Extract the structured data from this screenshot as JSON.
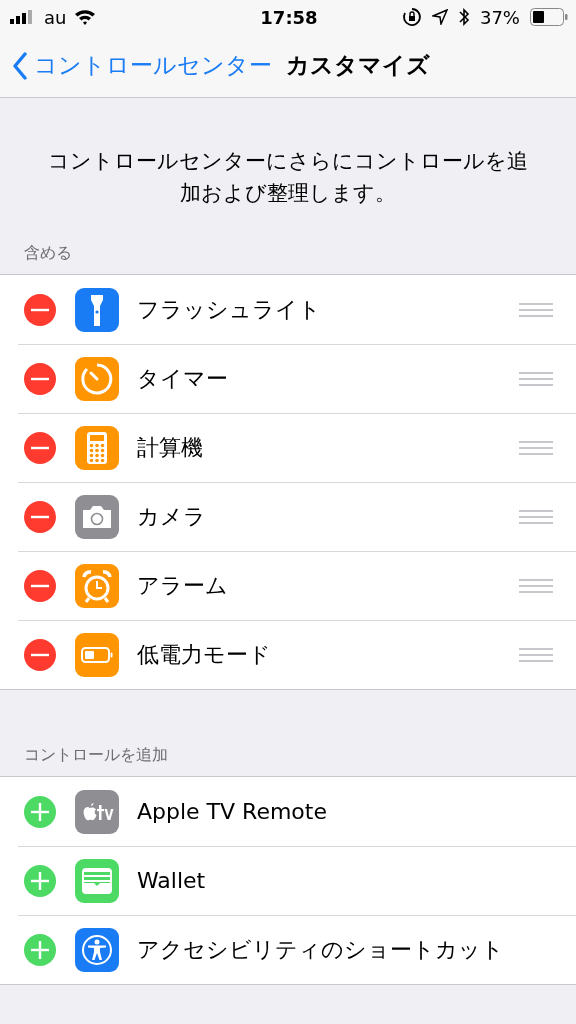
{
  "status_bar": {
    "carrier": "au",
    "time": "17:58",
    "battery_percent": "37%"
  },
  "nav": {
    "back": "コントロールセンター",
    "title": "カスタマイズ"
  },
  "description": "コントロールセンターにさらにコントロールを追加および整理します。",
  "sections": [
    {
      "header": "含める",
      "kind": "remove",
      "reorderable": true,
      "items": [
        {
          "label": "フラッシュライト",
          "kind": "flashlight",
          "color": "#1a7cf5"
        },
        {
          "label": "タイマー",
          "kind": "timer",
          "color": "#ff9500"
        },
        {
          "label": "計算機",
          "kind": "calculator",
          "color": "#ff9500"
        },
        {
          "label": "カメラ",
          "kind": "camera",
          "color": "#8e8e93"
        },
        {
          "label": "アラーム",
          "kind": "alarm",
          "color": "#ff9500"
        },
        {
          "label": "低電力モード",
          "kind": "battery",
          "color": "#ff9500"
        }
      ]
    },
    {
      "header": "コントロールを追加",
      "kind": "add",
      "reorderable": false,
      "items": [
        {
          "label": "Apple TV Remote",
          "kind": "tv",
          "color": "#8e8e93"
        },
        {
          "label": "Wallet",
          "kind": "wallet",
          "color": "#4cd964"
        },
        {
          "label": "アクセシビリティのショートカット",
          "kind": "accessibility",
          "color": "#1a7cf5"
        }
      ]
    }
  ]
}
